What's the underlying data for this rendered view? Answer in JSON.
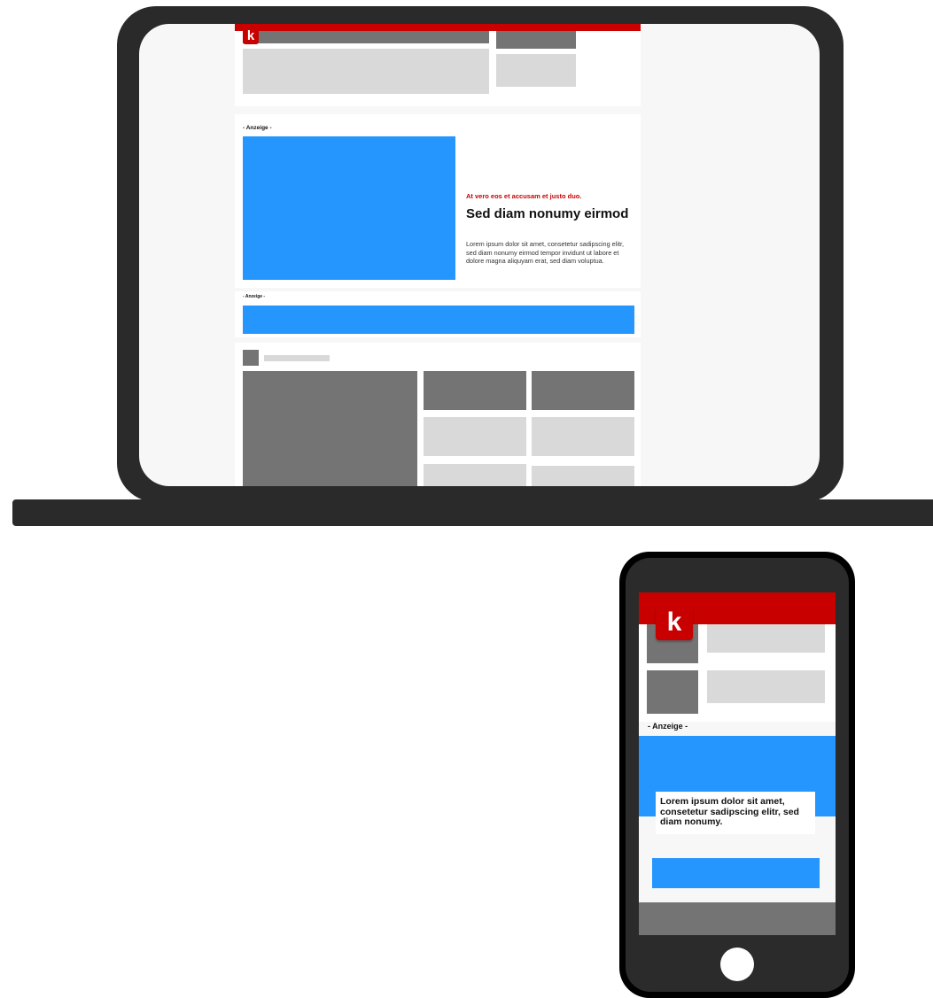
{
  "brand": {
    "logo_letter": "k",
    "red": "#c80000",
    "blue": "#2696ff",
    "dark_gray": "#747474",
    "light_gray": "#d9d9d9"
  },
  "laptop": {
    "logo_letter": "k",
    "ad_label_1": "- Anzeige -",
    "teaser": {
      "kicker": "At vero eos et accusam et justo duo.",
      "title": "Sed diam nonumy eirmod",
      "body": "Lorem ipsum dolor sit amet, consetetur sadipscing elitr, sed diam nonumy eirmod tempor invidunt ut labore et dolore magna aliquyam erat, sed diam voluptua."
    },
    "ad_label_2": "- Anzeige -"
  },
  "phone": {
    "logo_letter": "k",
    "ad_label": "- Anzeige -",
    "card_text": "Lorem ipsum dolor sit amet, consetetur sadipscing elitr, sed diam nonumy."
  }
}
